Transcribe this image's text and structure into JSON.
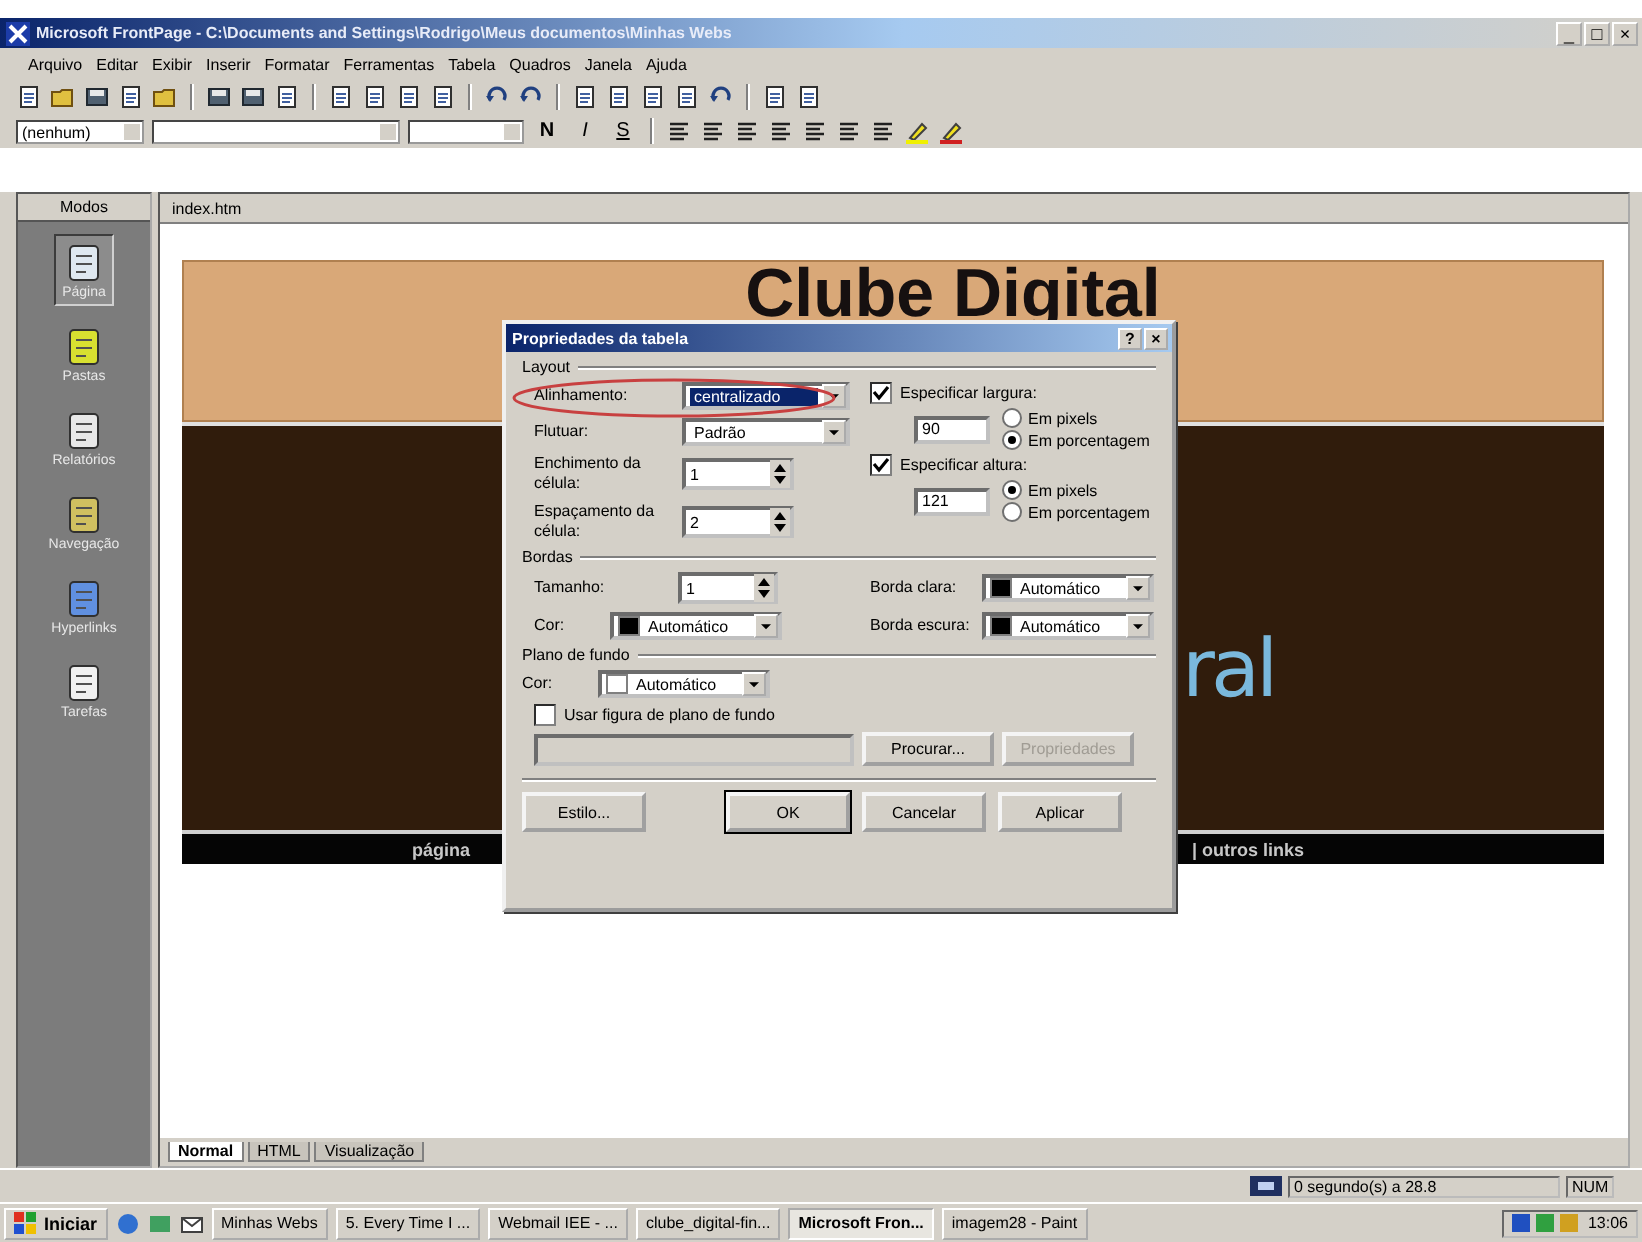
{
  "window": {
    "title": "Microsoft FrontPage - C:\\Documents and Settings\\Rodrigo\\Meus documentos\\Minhas Webs",
    "controls": [
      "_",
      "□",
      "×"
    ]
  },
  "menu": [
    "Arquivo",
    "Editar",
    "Exibir",
    "Inserir",
    "Formatar",
    "Ferramentas",
    "Tabela",
    "Quadros",
    "Janela",
    "Ajuda"
  ],
  "format_toolbar": {
    "style": "(nenhum)",
    "buttons": [
      "N",
      "I",
      "S"
    ]
  },
  "views": {
    "title": "Modos",
    "items": [
      {
        "label": "Página",
        "selected": true
      },
      {
        "label": "Pastas",
        "selected": false
      },
      {
        "label": "Relatórios",
        "selected": false
      },
      {
        "label": "Navegação",
        "selected": false
      },
      {
        "label": "Hyperlinks",
        "selected": false
      },
      {
        "label": "Tarefas",
        "selected": false
      }
    ]
  },
  "editor": {
    "tab": "index.htm",
    "page": {
      "heading": "Clube Digital",
      "subheading": "ral",
      "nav_left": "página",
      "nav_right": "| outros links"
    },
    "view_tabs": [
      {
        "label": "Normal",
        "selected": true
      },
      {
        "label": "HTML",
        "selected": false
      },
      {
        "label": "Visualização",
        "selected": false
      }
    ]
  },
  "dialog": {
    "title": "Propriedades da tabela",
    "title_buttons": [
      "?",
      "×"
    ],
    "layout": {
      "legend": "Layout",
      "fields": [
        {
          "label": "Alinhamento:",
          "kind": "select",
          "value": "centralizado",
          "highlighted": true
        },
        {
          "label": "Flutuar:",
          "kind": "select",
          "value": "Padrão",
          "highlighted": false
        },
        {
          "label": "Enchimento da célula:",
          "kind": "spin",
          "value": "1"
        },
        {
          "label": "Espaçamento da célula:",
          "kind": "spin",
          "value": "2"
        }
      ],
      "size": [
        {
          "label": "Especificar largura:",
          "checked": true,
          "value": "90",
          "units": [
            {
              "label": "Em pixels",
              "selected": false
            },
            {
              "label": "Em porcentagem",
              "selected": true
            }
          ]
        },
        {
          "label": "Especificar altura:",
          "checked": true,
          "value": "121",
          "units": [
            {
              "label": "Em pixels",
              "selected": true
            },
            {
              "label": "Em porcentagem",
              "selected": false
            }
          ]
        }
      ]
    },
    "borders": {
      "legend": "Bordas",
      "fields": [
        {
          "label": "Tamanho:",
          "kind": "spin",
          "value": "1"
        },
        {
          "label": "Borda clara:",
          "kind": "color",
          "value": "Automático",
          "color": "#000000"
        },
        {
          "label": "Cor:",
          "kind": "color",
          "value": "Automático",
          "color": "#000000"
        },
        {
          "label": "Borda escura:",
          "kind": "color",
          "value": "Automático",
          "color": "#000000"
        }
      ]
    },
    "background": {
      "legend": "Plano de fundo",
      "fields": [
        {
          "label": "Cor:",
          "kind": "color",
          "value": "Automático",
          "color": "#ffffff"
        }
      ],
      "image_option": {
        "label": "Usar figura de plano de fundo",
        "checked": false
      },
      "buttons": [
        {
          "label": "Procurar...",
          "disabled": false
        },
        {
          "label": "Propriedades",
          "disabled": true
        }
      ]
    },
    "buttons": [
      {
        "label": "Estilo...",
        "default": false
      },
      {
        "label": "OK",
        "default": true
      },
      {
        "label": "Cancelar",
        "default": false
      },
      {
        "label": "Aplicar",
        "default": false
      }
    ]
  },
  "status_bar": {
    "download_time": "0 segundo(s) a 28.8",
    "mode": "NUM"
  },
  "taskbar": {
    "start": "Iniciar",
    "tasks": [
      {
        "label": "Minhas Webs",
        "selected": false
      },
      {
        "label": "5. Every Time I ...",
        "selected": false
      },
      {
        "label": "Webmail IEE - ...",
        "selected": false
      },
      {
        "label": "clube_digital-fin...",
        "selected": false
      },
      {
        "label": "Microsoft Fron...",
        "selected": true
      },
      {
        "label": "imagem28 - Paint",
        "selected": false
      }
    ],
    "clock": "13:06"
  }
}
